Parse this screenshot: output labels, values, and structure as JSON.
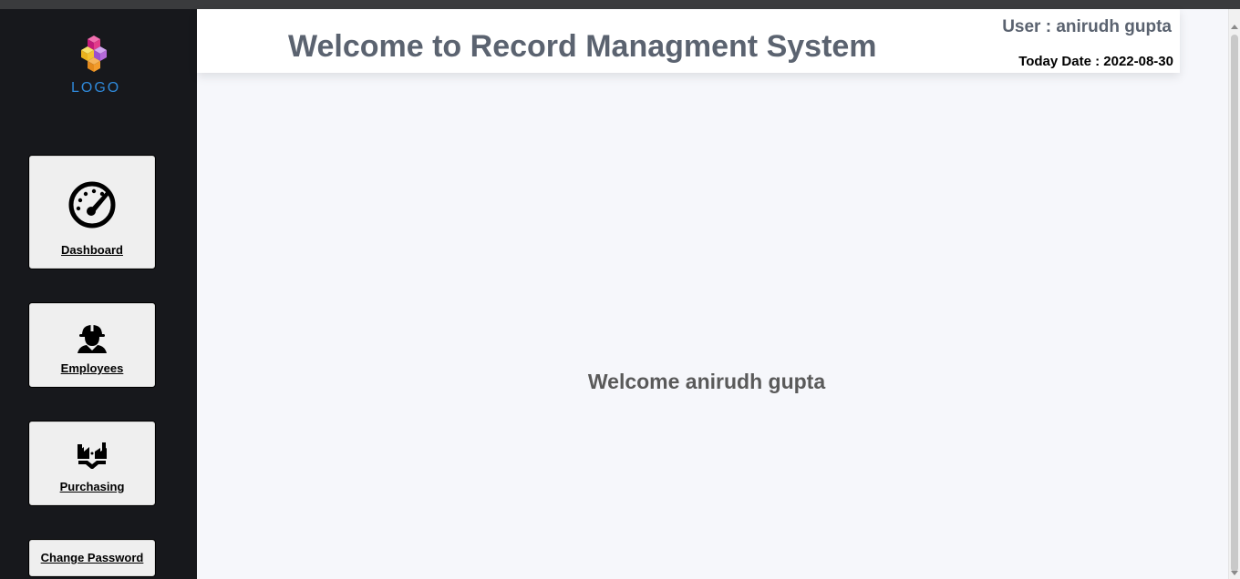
{
  "branding": {
    "logo_text": "LOGO",
    "brand_colors": [
      "#e23b8a",
      "#b56ad9",
      "#f2c230",
      "#2f88d8"
    ]
  },
  "header": {
    "title": "Welcome to Record Managment System",
    "user_text": "User : anirudh gupta",
    "date_text": "Today Date : 2022-08-30"
  },
  "sidebar": {
    "items": [
      {
        "label": "Dashboard",
        "icon": "speedometer-icon"
      },
      {
        "label": "Employees",
        "icon": "worker-icon"
      },
      {
        "label": "Purchasing",
        "icon": "factory-handshake-icon"
      },
      {
        "label": "Change Password"
      }
    ]
  },
  "main": {
    "welcome_text": "Welcome anirudh gupta"
  },
  "colors": {
    "sidebar_bg": "#17181c",
    "page_bg": "#f6f7fb",
    "header_text": "#5b6370",
    "card_bg": "#efefef"
  }
}
